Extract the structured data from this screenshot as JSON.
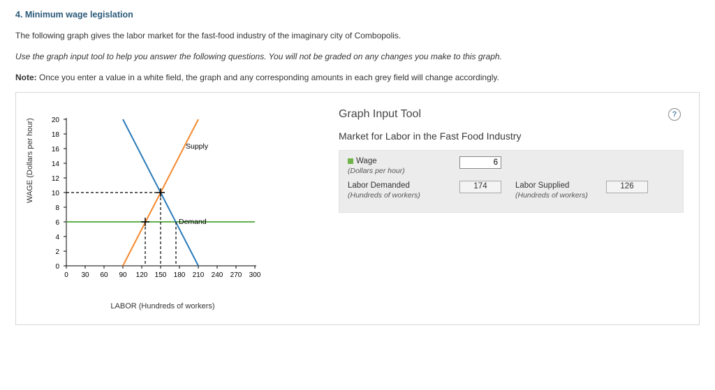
{
  "heading": "4. Minimum wage legislation",
  "intro": "The following graph gives the labor market for the fast-food industry of the imaginary city of Combopolis.",
  "instruction": "Use the graph input tool to help you answer the following questions. You will not be graded on any changes you make to this graph.",
  "note_label": "Note:",
  "note_text": " Once you enter a value in a white field, the graph and any corresponding amounts in each grey field will change accordingly.",
  "graph": {
    "ylabel": "WAGE (Dollars per hour)",
    "xlabel": "LABOR (Hundreds of workers)",
    "supply_label": "Supply",
    "demand_label": "Demand"
  },
  "tool": {
    "title": "Graph Input Tool",
    "subtitle": "Market for Labor in the Fast Food Industry",
    "wage_label": "Wage",
    "wage_sub": "(Dollars per hour)",
    "wage_value": "6",
    "demand_label": "Labor Demanded",
    "demand_sub": "(Hundreds of workers)",
    "demand_value": "174",
    "supply_label": "Labor Supplied",
    "supply_sub": "(Hundreds of workers)",
    "supply_value": "126"
  },
  "chart_data": {
    "type": "line",
    "xlabel": "LABOR (Hundreds of workers)",
    "ylabel": "WAGE (Dollars per hour)",
    "xlim": [
      0,
      300
    ],
    "ylim": [
      0,
      20
    ],
    "xticks": [
      0,
      30,
      60,
      90,
      120,
      150,
      180,
      210,
      240,
      270,
      300
    ],
    "yticks": [
      0,
      2,
      4,
      6,
      8,
      10,
      12,
      14,
      16,
      18,
      20
    ],
    "series": [
      {
        "name": "Supply",
        "color": "#f5892e",
        "points": [
          [
            90,
            0
          ],
          [
            210,
            20
          ]
        ]
      },
      {
        "name": "Demand",
        "color": "#2b7bb9",
        "points": [
          [
            90,
            20
          ],
          [
            210,
            0
          ]
        ]
      },
      {
        "name": "WageLine",
        "color": "#5fb04d",
        "points": [
          [
            0,
            6
          ],
          [
            300,
            6
          ]
        ]
      }
    ],
    "equilibrium": {
      "labor": 150,
      "wage": 10
    },
    "guides": {
      "dashed_h": {
        "x0": 0,
        "x1": 150,
        "y": 10
      },
      "dashed_v_supply": {
        "x": 126,
        "y0": 0,
        "y1": 6
      },
      "dashed_v_demand": {
        "x": 174,
        "y0": 0,
        "y1": 6
      },
      "dashed_v_eq": {
        "x": 150,
        "y0": 0,
        "y1": 10
      }
    }
  }
}
